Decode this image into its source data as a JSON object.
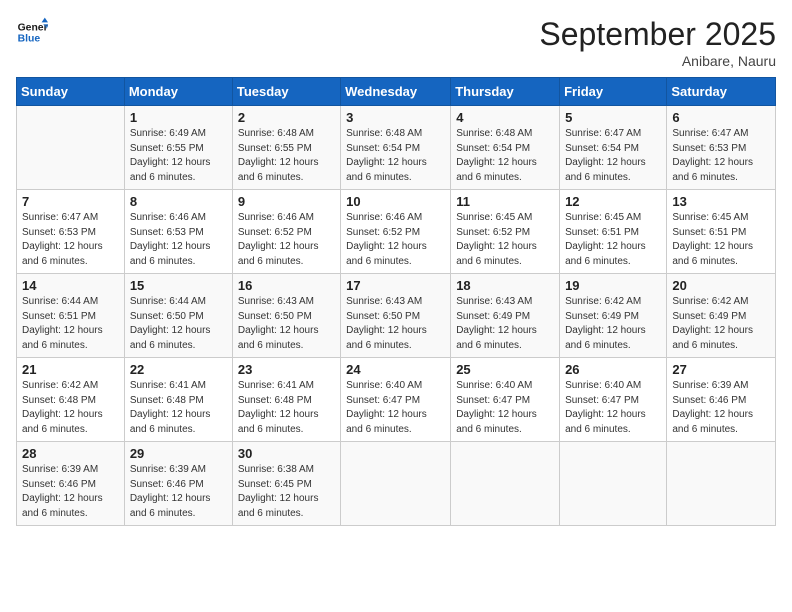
{
  "header": {
    "logo_general": "General",
    "logo_blue": "Blue",
    "month": "September 2025",
    "location": "Anibare, Nauru"
  },
  "days_of_week": [
    "Sunday",
    "Monday",
    "Tuesday",
    "Wednesday",
    "Thursday",
    "Friday",
    "Saturday"
  ],
  "weeks": [
    [
      {
        "day": "",
        "info": ""
      },
      {
        "day": "1",
        "info": "Sunrise: 6:49 AM\nSunset: 6:55 PM\nDaylight: 12 hours\nand 6 minutes."
      },
      {
        "day": "2",
        "info": "Sunrise: 6:48 AM\nSunset: 6:55 PM\nDaylight: 12 hours\nand 6 minutes."
      },
      {
        "day": "3",
        "info": "Sunrise: 6:48 AM\nSunset: 6:54 PM\nDaylight: 12 hours\nand 6 minutes."
      },
      {
        "day": "4",
        "info": "Sunrise: 6:48 AM\nSunset: 6:54 PM\nDaylight: 12 hours\nand 6 minutes."
      },
      {
        "day": "5",
        "info": "Sunrise: 6:47 AM\nSunset: 6:54 PM\nDaylight: 12 hours\nand 6 minutes."
      },
      {
        "day": "6",
        "info": "Sunrise: 6:47 AM\nSunset: 6:53 PM\nDaylight: 12 hours\nand 6 minutes."
      }
    ],
    [
      {
        "day": "7",
        "info": "Sunrise: 6:47 AM\nSunset: 6:53 PM\nDaylight: 12 hours\nand 6 minutes."
      },
      {
        "day": "8",
        "info": "Sunrise: 6:46 AM\nSunset: 6:53 PM\nDaylight: 12 hours\nand 6 minutes."
      },
      {
        "day": "9",
        "info": "Sunrise: 6:46 AM\nSunset: 6:52 PM\nDaylight: 12 hours\nand 6 minutes."
      },
      {
        "day": "10",
        "info": "Sunrise: 6:46 AM\nSunset: 6:52 PM\nDaylight: 12 hours\nand 6 minutes."
      },
      {
        "day": "11",
        "info": "Sunrise: 6:45 AM\nSunset: 6:52 PM\nDaylight: 12 hours\nand 6 minutes."
      },
      {
        "day": "12",
        "info": "Sunrise: 6:45 AM\nSunset: 6:51 PM\nDaylight: 12 hours\nand 6 minutes."
      },
      {
        "day": "13",
        "info": "Sunrise: 6:45 AM\nSunset: 6:51 PM\nDaylight: 12 hours\nand 6 minutes."
      }
    ],
    [
      {
        "day": "14",
        "info": "Sunrise: 6:44 AM\nSunset: 6:51 PM\nDaylight: 12 hours\nand 6 minutes."
      },
      {
        "day": "15",
        "info": "Sunrise: 6:44 AM\nSunset: 6:50 PM\nDaylight: 12 hours\nand 6 minutes."
      },
      {
        "day": "16",
        "info": "Sunrise: 6:43 AM\nSunset: 6:50 PM\nDaylight: 12 hours\nand 6 minutes."
      },
      {
        "day": "17",
        "info": "Sunrise: 6:43 AM\nSunset: 6:50 PM\nDaylight: 12 hours\nand 6 minutes."
      },
      {
        "day": "18",
        "info": "Sunrise: 6:43 AM\nSunset: 6:49 PM\nDaylight: 12 hours\nand 6 minutes."
      },
      {
        "day": "19",
        "info": "Sunrise: 6:42 AM\nSunset: 6:49 PM\nDaylight: 12 hours\nand 6 minutes."
      },
      {
        "day": "20",
        "info": "Sunrise: 6:42 AM\nSunset: 6:49 PM\nDaylight: 12 hours\nand 6 minutes."
      }
    ],
    [
      {
        "day": "21",
        "info": "Sunrise: 6:42 AM\nSunset: 6:48 PM\nDaylight: 12 hours\nand 6 minutes."
      },
      {
        "day": "22",
        "info": "Sunrise: 6:41 AM\nSunset: 6:48 PM\nDaylight: 12 hours\nand 6 minutes."
      },
      {
        "day": "23",
        "info": "Sunrise: 6:41 AM\nSunset: 6:48 PM\nDaylight: 12 hours\nand 6 minutes."
      },
      {
        "day": "24",
        "info": "Sunrise: 6:40 AM\nSunset: 6:47 PM\nDaylight: 12 hours\nand 6 minutes."
      },
      {
        "day": "25",
        "info": "Sunrise: 6:40 AM\nSunset: 6:47 PM\nDaylight: 12 hours\nand 6 minutes."
      },
      {
        "day": "26",
        "info": "Sunrise: 6:40 AM\nSunset: 6:47 PM\nDaylight: 12 hours\nand 6 minutes."
      },
      {
        "day": "27",
        "info": "Sunrise: 6:39 AM\nSunset: 6:46 PM\nDaylight: 12 hours\nand 6 minutes."
      }
    ],
    [
      {
        "day": "28",
        "info": "Sunrise: 6:39 AM\nSunset: 6:46 PM\nDaylight: 12 hours\nand 6 minutes."
      },
      {
        "day": "29",
        "info": "Sunrise: 6:39 AM\nSunset: 6:46 PM\nDaylight: 12 hours\nand 6 minutes."
      },
      {
        "day": "30",
        "info": "Sunrise: 6:38 AM\nSunset: 6:45 PM\nDaylight: 12 hours\nand 6 minutes."
      },
      {
        "day": "",
        "info": ""
      },
      {
        "day": "",
        "info": ""
      },
      {
        "day": "",
        "info": ""
      },
      {
        "day": "",
        "info": ""
      }
    ]
  ]
}
